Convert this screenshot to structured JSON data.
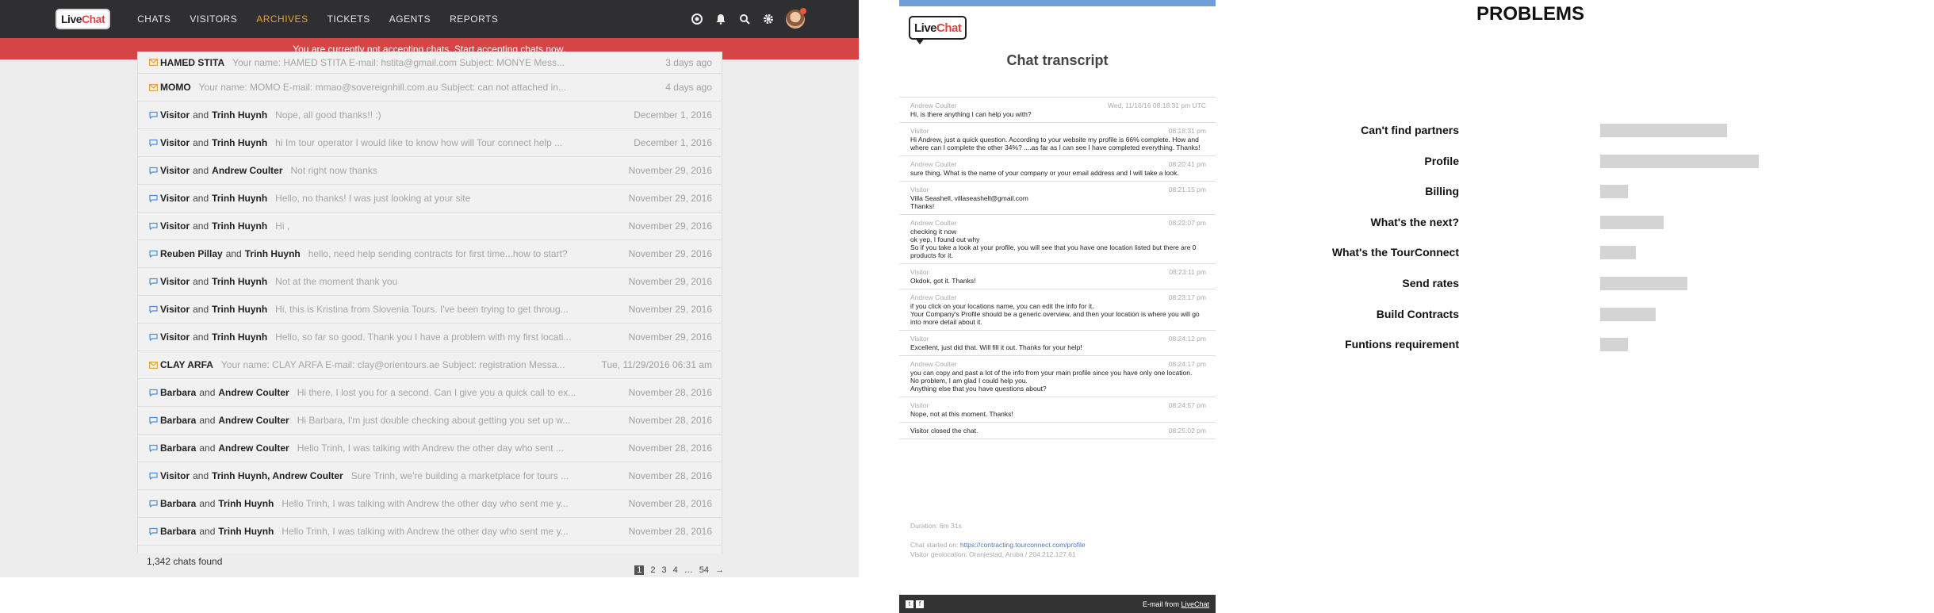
{
  "app": {
    "nav": [
      "CHATS",
      "VISITORS",
      "ARCHIVES",
      "TICKETS",
      "AGENTS",
      "REPORTS"
    ],
    "active_nav": "ARCHIVES",
    "alert_text": "You are currently not accepting chats.",
    "alert_link": "Start accepting chats now",
    "alert_end": ".",
    "rows": [
      {
        "type": "email",
        "p1": "HAMED STITA",
        "p2": "",
        "msg": "Your name: HAMED STITA E-mail: hstita@gmail.com Subject: MONYE Mess...",
        "date": "3 days ago"
      },
      {
        "type": "email",
        "p1": "MOMO",
        "p2": "",
        "msg": "Your name: MOMO E-mail: mmao@sovereignhill.com.au Subject: can not attached in...",
        "date": "4 days ago"
      },
      {
        "type": "chat",
        "p1": "Visitor",
        "p2": "Trinh Huynh",
        "msg": "Nope, all good thanks!! :)",
        "date": "December 1, 2016"
      },
      {
        "type": "chat",
        "p1": "Visitor",
        "p2": "Trinh Huynh",
        "msg": "hi Im tour operator I would like to know how will Tour connect help ...",
        "date": "December 1, 2016"
      },
      {
        "type": "chat",
        "p1": "Visitor",
        "p2": "Andrew Coulter",
        "msg": "Not right now thanks",
        "date": "November 29, 2016"
      },
      {
        "type": "chat",
        "p1": "Visitor",
        "p2": "Trinh Huynh",
        "msg": "Hello, no thanks! I was just looking at your site",
        "date": "November 29, 2016"
      },
      {
        "type": "chat",
        "p1": "Visitor",
        "p2": "Trinh Huynh",
        "msg": "Hi ,",
        "date": "November 29, 2016"
      },
      {
        "type": "chat",
        "p1": "Reuben Pillay",
        "p2": "Trinh Huynh",
        "msg": "hello, need help sending contracts for first time...how to start?",
        "date": "November 29, 2016"
      },
      {
        "type": "chat",
        "p1": "Visitor",
        "p2": "Trinh Huynh",
        "msg": "Not at the moment thank you",
        "date": "November 29, 2016"
      },
      {
        "type": "chat",
        "p1": "Visitor",
        "p2": "Trinh Huynh",
        "msg": "Hi, this is Kristina from Slovenia Tours. I've been trying to get throug...",
        "date": "November 29, 2016"
      },
      {
        "type": "chat",
        "p1": "Visitor",
        "p2": "Trinh Huynh",
        "msg": "Hello, so far so good. Thank you I have a problem with my first locati...",
        "date": "November 29, 2016"
      },
      {
        "type": "email",
        "p1": "CLAY ARFA",
        "p2": "",
        "msg": "Your name: CLAY ARFA E-mail: clay@orientours.ae Subject: registration Messa...",
        "date": "Tue, 11/29/2016 06:31 am"
      },
      {
        "type": "chat",
        "p1": "Barbara",
        "p2": "Andrew Coulter",
        "msg": "Hi there, I lost you for a second. Can I give you a quick call to ex...",
        "date": "November 28, 2016"
      },
      {
        "type": "chat",
        "p1": "Barbara",
        "p2": "Andrew Coulter",
        "msg": "Hi Barbara, I'm just double checking about getting you set up w...",
        "date": "November 28, 2016"
      },
      {
        "type": "chat",
        "p1": "Barbara",
        "p2": "Andrew Coulter",
        "msg": "Hello Trinh, I was talking with Andrew the other day who sent ...",
        "date": "November 28, 2016"
      },
      {
        "type": "chat",
        "p1": "Visitor",
        "p2": "Trinh Huynh, Andrew Coulter",
        "msg": "Sure Trinh, we're building a marketplace for tours ...",
        "date": "November 28, 2016"
      },
      {
        "type": "chat",
        "p1": "Barbara",
        "p2": "Trinh Huynh",
        "msg": "Hello Trinh, I was talking with Andrew the other day who sent me y...",
        "date": "November 28, 2016"
      },
      {
        "type": "chat",
        "p1": "Barbara",
        "p2": "Trinh Huynh",
        "msg": "Hello Trinh, I was talking with Andrew the other day who sent me y...",
        "date": "November 28, 2016"
      }
    ],
    "and_word": "and",
    "count_text": "1,342 chats found",
    "pages": [
      "1",
      "2",
      "3",
      "4",
      "…",
      "54",
      "→"
    ],
    "current_page": "1"
  },
  "transcript": {
    "title": "Chat transcript",
    "messages": [
      {
        "who": "Andrew Coulter",
        "time": "Wed, 11/16/16 08:18:31 pm UTC",
        "text": "Hi, is there anything I can help you with?"
      },
      {
        "who": "Visitor",
        "time": "08:18:31 pm",
        "text": "Hi Andrew, just a quick question. According to your website my profile is 66% complete. How and where can I complete the other 34%? ....as far as I can see I have completed everything. Thanks!"
      },
      {
        "who": "Andrew Coulter",
        "time": "08:20:41 pm",
        "text": "sure thing. What is the name of your company or your email address and I will take a look."
      },
      {
        "who": "Visitor",
        "time": "08:21:15 pm",
        "text": "Villa Seashell, villaseashell@gmail.com\nThanks!"
      },
      {
        "who": "Andrew Coulter",
        "time": "08:22:07 pm",
        "text": "checking it now\nok yep, I found out why\nSo if you take a look at your profile, you will see that you have one location listed but there are 0 products for it."
      },
      {
        "who": "Visitor",
        "time": "08:23:11 pm",
        "text": "Okdok, got it. Thanks!"
      },
      {
        "who": "Andrew Coulter",
        "time": "08:23:17 pm",
        "text": "if you click on your locations name, you can edit the info for it.\nYour Company's Profile should be a generic overview, and then your location is where you will go into more detail about it."
      },
      {
        "who": "Visitor",
        "time": "08:24:12 pm",
        "text": "Excellent, just did that. Will fill it out. Thanks for your help!"
      },
      {
        "who": "Andrew Coulter",
        "time": "08:24:17 pm",
        "text": "you can copy and past a lot of the info from your main profile since you have only one location.\nNo problem, I am glad I could help you.\nAnything else that you have questions about?"
      },
      {
        "who": "Visitor",
        "time": "08:24:57 pm",
        "text": "Nope, not at this moment. Thanks!"
      }
    ],
    "closed_text": "Visitor closed the chat.",
    "closed_time": "08:25:02 pm",
    "duration": "Duration: 6m 31s",
    "started_label": "Chat started on:",
    "started_url": "https://contracting.tourconnect.com/profile",
    "geo": "Visitor geolocation: Oranjestad, Aruba / 204.212.127.61",
    "footer_left_icons": [
      "t",
      "f"
    ],
    "footer_right": "E-mail from",
    "footer_brand": "LiveChat"
  },
  "chart_data": {
    "type": "bar",
    "title": "PROBLEMS",
    "orientation": "horizontal",
    "categories": [
      "Can't find partners",
      "Profile",
      "Billing",
      "What's the next?",
      "What's the TourConnect",
      "Send rates",
      "Build Contracts",
      "Funtions requirement"
    ],
    "values": [
      16,
      20,
      3.5,
      8,
      4.5,
      11,
      7,
      3.5
    ],
    "xlabel": "",
    "ylabel": "",
    "axis_visible": false,
    "bar_color": "#d4d4d4"
  }
}
